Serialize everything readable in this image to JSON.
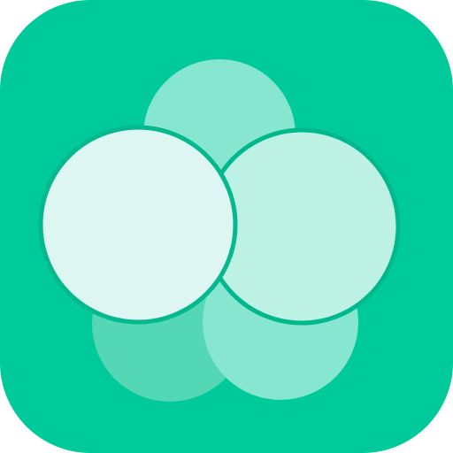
{
  "icon": {
    "name": "flower-circles-app-icon",
    "colors": {
      "tile": "#00C99A",
      "petal_top": "#86E6CF",
      "petal_bottom_left": "#54D7B5",
      "petal_bottom_right": "#86E6CF",
      "petal_right": "#BDF1E4",
      "petal_left": "#DDF6F1",
      "petal_stroke": "#00B88D",
      "inner_shadow": "#19B68F"
    }
  }
}
